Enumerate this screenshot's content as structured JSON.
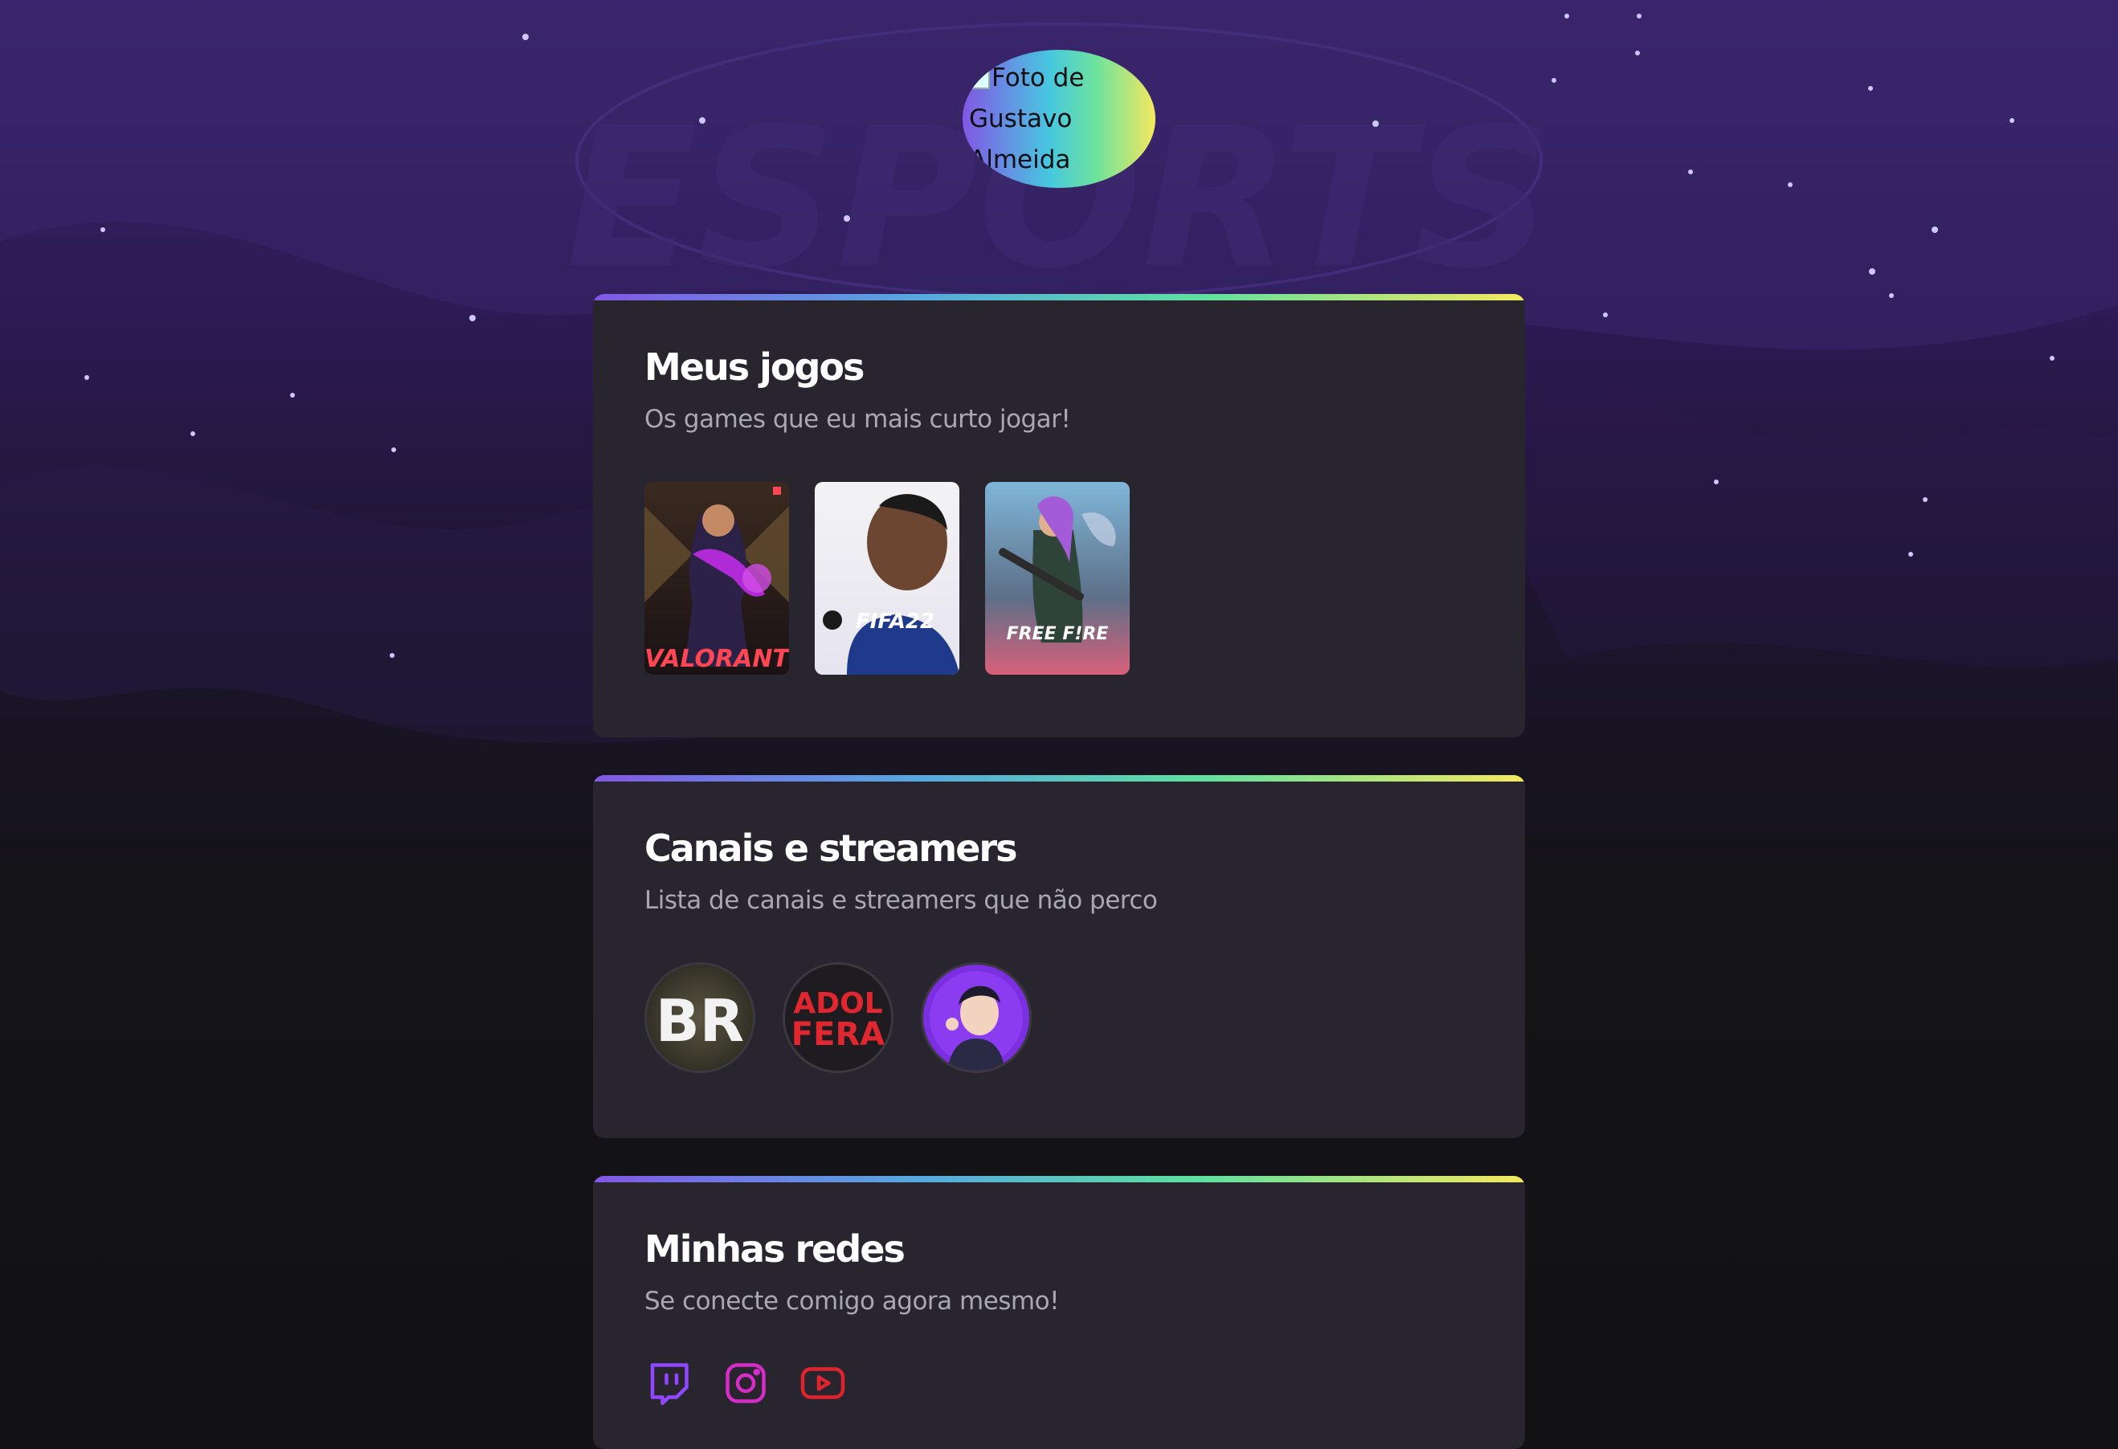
{
  "avatar": {
    "alt_text": "Foto de Gustavo Almeida"
  },
  "games_section": {
    "title": "Meus jogos",
    "subtitle": "Os games que eu mais curto jogar!",
    "games": [
      {
        "name": "VALORANT"
      },
      {
        "name": "FIFA22"
      },
      {
        "name": "FREE F!RE"
      }
    ]
  },
  "streamers_section": {
    "title": "Canais e streamers",
    "subtitle": "Lista de canais e streamers que não perco",
    "streamers": [
      {
        "label": "BR"
      },
      {
        "label_line1": "ADOL",
        "label_line2": "FERA"
      },
      {
        "label": ""
      }
    ]
  },
  "social_section": {
    "title": "Minhas redes",
    "subtitle": "Se conecte comigo agora mesmo!",
    "icons": [
      "twitch-icon",
      "instagram-icon",
      "youtube-icon"
    ]
  },
  "colors": {
    "background": "#121214",
    "card": "#29252f",
    "gradient_start": "#8257e5",
    "gradient_end": "#f5e85f",
    "twitch": "#9147ff",
    "instagram": "#d62dc7",
    "youtube": "#e0242e"
  }
}
